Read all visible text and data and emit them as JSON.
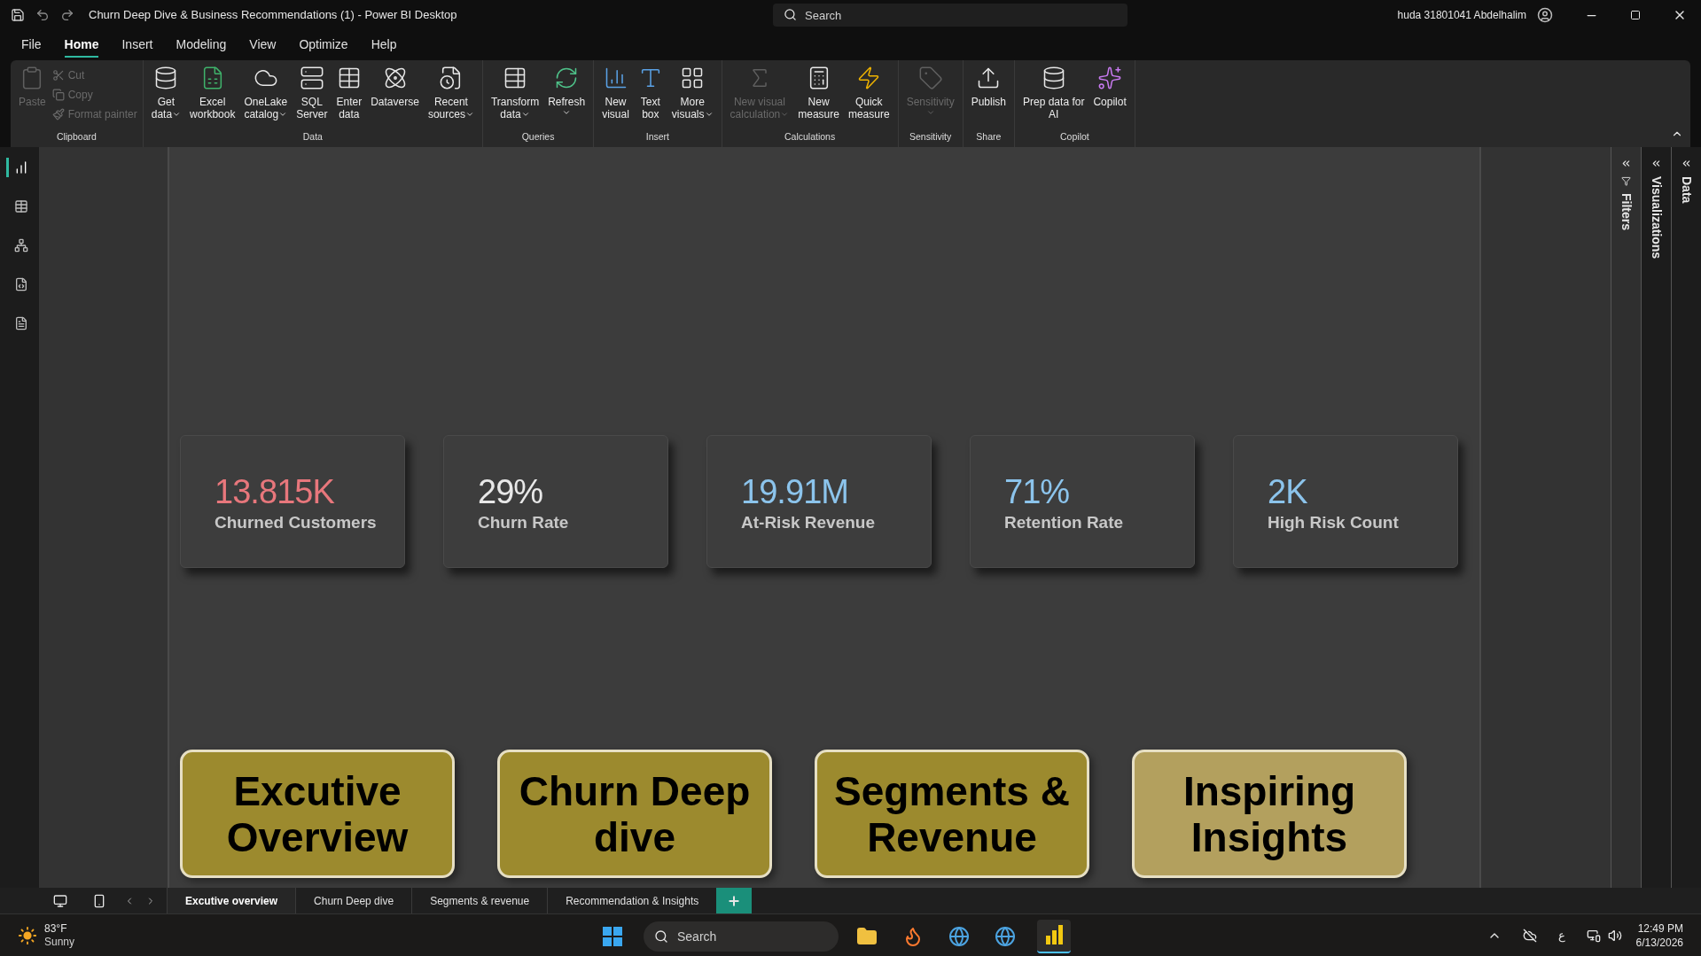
{
  "window": {
    "title": "Churn Deep Dive & Business Recommendations (1) - Power BI Desktop",
    "search_placeholder": "Search",
    "user": "huda 31801041 Abdelhalim"
  },
  "menu": [
    {
      "label": "File",
      "selected": false
    },
    {
      "label": "Home",
      "selected": true
    },
    {
      "label": "Insert",
      "selected": false
    },
    {
      "label": "Modeling",
      "selected": false
    },
    {
      "label": "View",
      "selected": false
    },
    {
      "label": "Optimize",
      "selected": false
    },
    {
      "label": "Help",
      "selected": false
    }
  ],
  "ribbon": [
    {
      "label": "Clipboard",
      "items": [
        {
          "kind": "large",
          "lines": [
            "Paste"
          ],
          "disabled": true,
          "dropdown": false
        },
        {
          "kind": "small",
          "lines": [
            "Cut"
          ],
          "disabled": true
        },
        {
          "kind": "small",
          "lines": [
            "Copy"
          ],
          "disabled": true
        },
        {
          "kind": "small",
          "lines": [
            "Format painter"
          ],
          "disabled": true
        }
      ]
    },
    {
      "label": "Data",
      "items": [
        {
          "kind": "large",
          "lines": [
            "Get",
            "data"
          ],
          "disabled": false,
          "dropdown": true
        },
        {
          "kind": "large",
          "lines": [
            "Excel",
            "workbook"
          ],
          "disabled": false,
          "dropdown": false
        },
        {
          "kind": "large",
          "lines": [
            "OneLake",
            "catalog"
          ],
          "disabled": false,
          "dropdown": true
        },
        {
          "kind": "large",
          "lines": [
            "SQL",
            "Server"
          ],
          "disabled": false,
          "dropdown": false
        },
        {
          "kind": "large",
          "lines": [
            "Enter",
            "data"
          ],
          "disabled": false,
          "dropdown": false
        },
        {
          "kind": "large",
          "lines": [
            "Dataverse"
          ],
          "disabled": false,
          "dropdown": false
        },
        {
          "kind": "large",
          "lines": [
            "Recent",
            "sources"
          ],
          "disabled": false,
          "dropdown": true
        }
      ]
    },
    {
      "label": "Queries",
      "items": [
        {
          "kind": "large",
          "lines": [
            "Transform",
            "data"
          ],
          "disabled": false,
          "dropdown": true
        },
        {
          "kind": "large",
          "lines": [
            "Refresh"
          ],
          "disabled": false,
          "dropdown": true
        }
      ]
    },
    {
      "label": "Insert",
      "items": [
        {
          "kind": "large",
          "lines": [
            "New",
            "visual"
          ],
          "disabled": false,
          "dropdown": false
        },
        {
          "kind": "large",
          "lines": [
            "Text",
            "box"
          ],
          "disabled": false,
          "dropdown": false
        },
        {
          "kind": "large",
          "lines": [
            "More",
            "visuals"
          ],
          "disabled": false,
          "dropdown": true
        }
      ]
    },
    {
      "label": "Calculations",
      "items": [
        {
          "kind": "large",
          "lines": [
            "New visual",
            "calculation"
          ],
          "disabled": true,
          "dropdown": true
        },
        {
          "kind": "large",
          "lines": [
            "New",
            "measure"
          ],
          "disabled": false,
          "dropdown": false
        },
        {
          "kind": "large",
          "lines": [
            "Quick",
            "measure"
          ],
          "disabled": false,
          "dropdown": false
        }
      ]
    },
    {
      "label": "Sensitivity",
      "items": [
        {
          "kind": "large",
          "lines": [
            "Sensitivity"
          ],
          "disabled": true,
          "dropdown": true
        }
      ]
    },
    {
      "label": "Share",
      "items": [
        {
          "kind": "large",
          "lines": [
            "Publish"
          ],
          "disabled": false,
          "dropdown": false
        }
      ]
    },
    {
      "label": "Copilot",
      "items": [
        {
          "kind": "large",
          "lines": [
            "Prep data for",
            "AI"
          ],
          "disabled": false,
          "dropdown": false
        },
        {
          "kind": "large",
          "lines": [
            "Copilot"
          ],
          "disabled": false,
          "dropdown": false
        }
      ]
    }
  ],
  "views": [
    {
      "kind": "report",
      "selected": true
    },
    {
      "kind": "table",
      "selected": false
    },
    {
      "kind": "model",
      "selected": false
    },
    {
      "kind": "dax",
      "selected": false
    },
    {
      "kind": "tmdl",
      "selected": false
    }
  ],
  "cards": [
    {
      "value": "13.815K",
      "label": "Churned Customers",
      "color": "#e8777c"
    },
    {
      "value": "29%",
      "label": "Churn Rate",
      "color": "#e8e8e8"
    },
    {
      "value": "19.91M",
      "label": "At-Risk Revenue",
      "color": "#8cc4ec"
    },
    {
      "value": "71%",
      "label": "Retention Rate",
      "color": "#8cc4ec"
    },
    {
      "value": "2K",
      "label": "High Risk Count",
      "color": "#8cc4ec"
    }
  ],
  "nav_buttons": [
    {
      "label": "Excutive Overview",
      "color": "#9c8a2e"
    },
    {
      "label": "Churn Deep dive",
      "color": "#9c8a2e"
    },
    {
      "label": "Segments & Revenue",
      "color": "#9c8a2e"
    },
    {
      "label": "Inspiring Insights",
      "color": "#b3a05e"
    }
  ],
  "panes": [
    {
      "label": "Filters",
      "kind": "filters"
    },
    {
      "label": "Visualizations",
      "kind": "plain"
    },
    {
      "label": "Data",
      "kind": "plain"
    }
  ],
  "page_tabs": [
    {
      "label": "Excutive overview",
      "selected": true
    },
    {
      "label": "Churn Deep dive",
      "selected": false
    },
    {
      "label": "Segments & revenue",
      "selected": false
    },
    {
      "label": "Recommendation & Insights",
      "selected": false
    }
  ],
  "taskbar": {
    "temperature": "83°F",
    "weather": "Sunny",
    "search_placeholder": "Search",
    "input_language": "ع",
    "time": "12:49 PM",
    "date": "6/13/2026"
  }
}
